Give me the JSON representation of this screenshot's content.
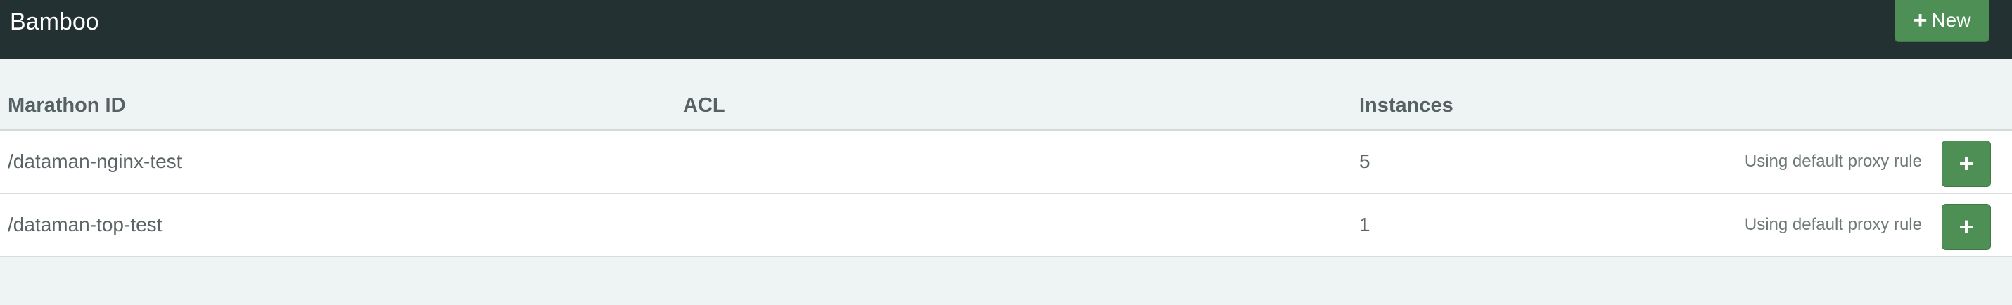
{
  "app": {
    "brand": "Bamboo",
    "new_button": {
      "icon": "+",
      "label": "New"
    }
  },
  "table": {
    "columns": [
      "Marathon ID",
      "ACL",
      "Instances"
    ],
    "rows": [
      {
        "id": "/dataman-nginx-test",
        "acl": "",
        "instances": "5",
        "rule": "Using default proxy rule",
        "add_icon": "+"
      },
      {
        "id": "/dataman-top-test",
        "acl": "",
        "instances": "1",
        "rule": "Using default proxy rule",
        "add_icon": "+"
      }
    ]
  },
  "colors": {
    "topbar": "#243133",
    "page_bg": "#eef3f3",
    "accent_green": "#4e8f55"
  }
}
